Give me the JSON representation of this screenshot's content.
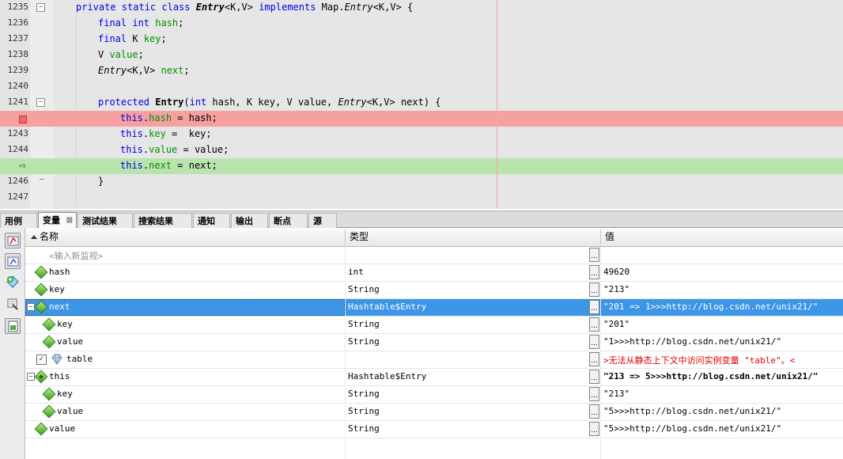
{
  "editor": {
    "lines": [
      {
        "num": "1235",
        "type": "normal",
        "fold": "open",
        "tokens": [
          {
            "t": "private static class ",
            "c": "kw"
          },
          {
            "t": "Entry",
            "c": "ital bold"
          },
          {
            "t": "<K,V> "
          },
          {
            "t": "implements",
            "c": "kw"
          },
          {
            "t": " Map."
          },
          {
            "t": "Entry",
            "c": "ital"
          },
          {
            "t": "<K,V> {"
          }
        ],
        "indent": 96
      },
      {
        "num": "1236",
        "type": "normal",
        "tokens": [
          {
            "t": "final int ",
            "c": "kw"
          },
          {
            "t": "hash",
            "c": "fld"
          },
          {
            "t": ";"
          }
        ],
        "indent": 124
      },
      {
        "num": "1237",
        "type": "normal",
        "tokens": [
          {
            "t": "final",
            "c": "kw"
          },
          {
            "t": " K "
          },
          {
            "t": "key",
            "c": "fld"
          },
          {
            "t": ";"
          }
        ],
        "indent": 124
      },
      {
        "num": "1238",
        "type": "normal",
        "tokens": [
          {
            "t": "V "
          },
          {
            "t": "value",
            "c": "fld"
          },
          {
            "t": ";"
          }
        ],
        "indent": 124
      },
      {
        "num": "1239",
        "type": "normal",
        "tokens": [
          {
            "t": "Entry",
            "c": "ital"
          },
          {
            "t": "<K,V> "
          },
          {
            "t": "next",
            "c": "fld"
          },
          {
            "t": ";"
          }
        ],
        "indent": 124
      },
      {
        "num": "1240",
        "type": "normal",
        "tokens": [],
        "indent": 124
      },
      {
        "num": "1241",
        "type": "normal",
        "fold": "open",
        "tokens": [
          {
            "t": "protected ",
            "c": "kw"
          },
          {
            "t": "Entry",
            "c": "bold"
          },
          {
            "t": "("
          },
          {
            "t": "int",
            "c": "kw"
          },
          {
            "t": " hash, K key, V value, "
          },
          {
            "t": "Entry",
            "c": "ital"
          },
          {
            "t": "<K,V> next) {"
          }
        ],
        "indent": 124
      },
      {
        "num": "",
        "type": "breakpoint",
        "tokens": [
          {
            "t": "this",
            "c": "kw"
          },
          {
            "t": "."
          },
          {
            "t": "hash",
            "c": "fld"
          },
          {
            "t": " = hash;"
          }
        ],
        "indent": 152
      },
      {
        "num": "1243",
        "type": "normal",
        "tokens": [
          {
            "t": "this",
            "c": "kw"
          },
          {
            "t": "."
          },
          {
            "t": "key",
            "c": "fld"
          },
          {
            "t": " =  key;"
          }
        ],
        "indent": 152
      },
      {
        "num": "1244",
        "type": "normal",
        "tokens": [
          {
            "t": "this",
            "c": "kw"
          },
          {
            "t": "."
          },
          {
            "t": "value",
            "c": "fld"
          },
          {
            "t": " = value;"
          }
        ],
        "indent": 152
      },
      {
        "num": "",
        "type": "current",
        "tokens": [
          {
            "t": "this",
            "c": "kw"
          },
          {
            "t": "."
          },
          {
            "t": "next",
            "c": "fld"
          },
          {
            "t": " = next;"
          }
        ],
        "indent": 152
      },
      {
        "num": "1246",
        "type": "normal",
        "fold": "end",
        "tokens": [
          {
            "t": "}"
          }
        ],
        "indent": 124
      },
      {
        "num": "1247",
        "type": "normal",
        "tokens": [],
        "indent": 124
      }
    ]
  },
  "tabs": [
    {
      "label": "用例",
      "active": false
    },
    {
      "label": "变量",
      "active": true,
      "close": "⊠"
    },
    {
      "label": "测试结果",
      "active": false
    },
    {
      "label": "搜索结果",
      "active": false
    },
    {
      "label": "通知",
      "active": false
    },
    {
      "label": "输出",
      "active": false
    },
    {
      "label": "断点",
      "active": false
    },
    {
      "label": "源",
      "active": false
    }
  ],
  "columns": {
    "name": "名称",
    "type": "类型",
    "value": "值"
  },
  "rows": [
    {
      "name": "<输入新监视>",
      "type": "",
      "value": "",
      "level": 0,
      "placeholder": true,
      "icon": "none"
    },
    {
      "name": "hash",
      "type": "int",
      "value": "49620",
      "level": 0,
      "icon": "diamond"
    },
    {
      "name": "key",
      "type": "String",
      "value": "\"213\"",
      "level": 0,
      "icon": "diamond"
    },
    {
      "name": "next",
      "type": "Hashtable$Entry",
      "value": "\"201 => 1>>>http://blog.csdn.net/unix21/\"",
      "level": 0,
      "icon": "diamond",
      "expander": "−",
      "selected": true
    },
    {
      "name": "key",
      "type": "String",
      "value": "\"201\"",
      "level": 1,
      "icon": "diamond"
    },
    {
      "name": "value",
      "type": "String",
      "value": "\"1>>>http://blog.csdn.net/unix21/\"",
      "level": 1,
      "icon": "diamond"
    },
    {
      "name": "table",
      "type": "",
      "value": ">无法从静态上下文中访问实例变量 \"table\"。<",
      "level": 1,
      "icon": "gem",
      "checkbox": "✓",
      "error": true
    },
    {
      "name": "this",
      "type": "Hashtable$Entry",
      "value": "\"213 => 5>>>http://blog.csdn.net/unix21/\"",
      "level": 0,
      "icon": "diamond-dot",
      "expander": "−",
      "boldValue": true
    },
    {
      "name": "key",
      "type": "String",
      "value": "\"213\"",
      "level": 1,
      "icon": "diamond"
    },
    {
      "name": "value",
      "type": "String",
      "value": "\"5>>>http://blog.csdn.net/unix21/\"",
      "level": 1,
      "icon": "diamond"
    },
    {
      "name": "value",
      "type": "String",
      "value": "\"5>>>http://blog.csdn.net/unix21/\"",
      "level": 0,
      "icon": "diamond"
    }
  ],
  "value_button_label": "...",
  "sidebar_icons": [
    "watch-icon",
    "watch-alt-icon",
    "add-watch-icon",
    "filter-icon",
    "view-options-icon"
  ]
}
